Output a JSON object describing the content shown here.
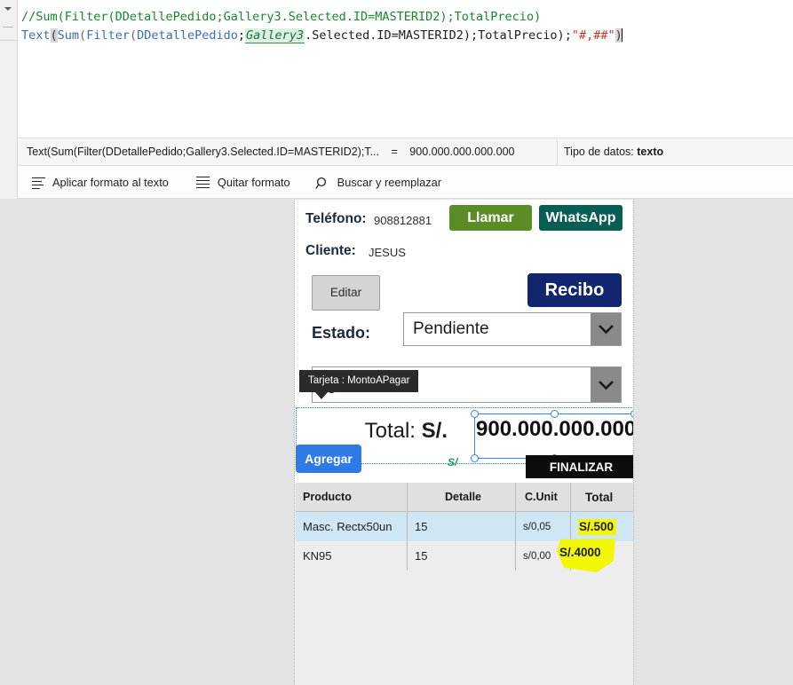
{
  "formula_editor": {
    "gutter_icon": "collapse-caret",
    "line1": {
      "text": "//Sum(Filter(DDetallePedido;Gallery3.Selected.ID=MASTERID2);TotalPrecio)",
      "kind": "comment"
    },
    "line2_tokens": [
      {
        "t": "Text",
        "k": "fn"
      },
      {
        "t": "(",
        "k": "paren-match"
      },
      {
        "t": "Sum",
        "k": "fn"
      },
      {
        "t": "(",
        "k": "paren"
      },
      {
        "t": "Filter",
        "k": "fn"
      },
      {
        "t": "(",
        "k": "paren"
      },
      {
        "t": "DDetallePedido",
        "k": "ident"
      },
      {
        "t": ";",
        "k": "plain"
      },
      {
        "t": "Gallery3",
        "k": "highlight"
      },
      {
        "t": ".Selected.ID=MASTERID2)",
        "k": "plain"
      },
      {
        "t": ";TotalPrecio)",
        "k": "plain"
      },
      {
        "t": ";",
        "k": "plain"
      },
      {
        "t": "\"#,##\"",
        "k": "string"
      },
      {
        "t": ")",
        "k": "paren-match"
      }
    ]
  },
  "result_bar": {
    "expression": "Text(Sum(Filter(DDetallePedido;Gallery3.Selected.ID=MASTERID2);T...",
    "equals": "=",
    "value": "900.000.000.000.000",
    "datatype_label": "Tipo de datos:",
    "datatype_value": "texto"
  },
  "toolbar": {
    "apply_format": "Aplicar formato al texto",
    "clear_format": "Quitar formato",
    "find_replace": "Buscar y reemplazar"
  },
  "app": {
    "phone_label": "Teléfono:",
    "phone_value": "908812881",
    "btn_llamar": "Llamar",
    "btn_whatsapp": "WhatsApp",
    "client_label": "Cliente:",
    "client_value": "JESUS",
    "btn_editar": "Editar",
    "btn_recibo": "Recibo",
    "estado_label": "Estado:",
    "estado_value": "Pendiente",
    "payment_value": "rge",
    "tooltip": "Tarjeta : MontoAPagar",
    "total_label": "Total:",
    "total_currency": "S/.",
    "total_value": "900.000.000.000",
    "sub_currency": "S/",
    "btn_agregar": "Agregar",
    "btn_finalizar": "FINALIZAR"
  },
  "table": {
    "headers": [
      "Producto",
      "Detalle",
      "C.Unit",
      "Total"
    ],
    "rows": [
      {
        "producto": "Masc. Rectx50un",
        "detalle": "15",
        "cunit": "s/0,05",
        "total": "S/.500",
        "selected": true,
        "highlight": "solid"
      },
      {
        "producto": "KN95",
        "detalle": "15",
        "cunit": "s/0,00",
        "total": "S/.4000",
        "selected": false,
        "highlight": "blob"
      }
    ]
  },
  "colors": {
    "llamar": "#5b8c26",
    "whatsapp": "#075e54",
    "recibo": "#11266e",
    "agregar": "#2f7ae5",
    "finalizar": "#0d0d0d",
    "highlight_yellow": "#f2f70a",
    "selection_blue": "#2f88e0",
    "row_selected": "#cfe6f4",
    "comment_green": "#14892c",
    "string_red": "#c0392b",
    "fn_blue": "#3a6fb5"
  }
}
